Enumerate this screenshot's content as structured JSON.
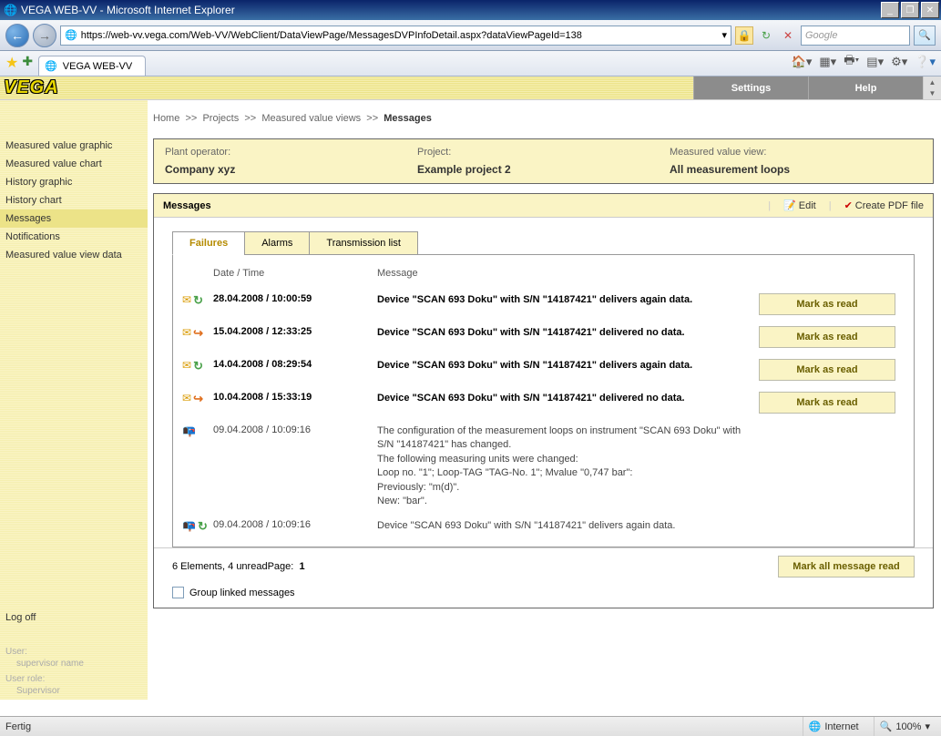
{
  "window": {
    "title": "VEGA WEB-VV - Microsoft Internet Explorer"
  },
  "browser": {
    "url": "https://web-vv.vega.com/Web-VV/WebClient/DataViewPage/MessagesDVPInfoDetail.aspx?dataViewPageId=138",
    "search_placeholder": "Google",
    "tab_title": "VEGA WEB-VV"
  },
  "header": {
    "logo": "VEGA",
    "settings": "Settings",
    "help": "Help"
  },
  "breadcrumb": {
    "home": "Home",
    "projects": "Projects",
    "views": "Measured value views",
    "current": "Messages",
    "sep": ">>"
  },
  "sidebar": {
    "items": [
      "Measured value graphic",
      "Measured value chart",
      "History graphic",
      "History chart",
      "Messages",
      "Notifications",
      "Measured value view data"
    ],
    "active_index": 4,
    "logoff": "Log off",
    "user_label": "User:",
    "user_value": "supervisor name",
    "role_label": "User role:",
    "role_value": "Supervisor"
  },
  "info": {
    "operator_label": "Plant operator:",
    "operator_value": "Company xyz",
    "project_label": "Project:",
    "project_value": "Example project 2",
    "view_label": "Measured value view:",
    "view_value": "All measurement loops"
  },
  "panel": {
    "title": "Messages",
    "edit": "Edit",
    "create_pdf": "Create PDF file"
  },
  "tabs": {
    "failures": "Failures",
    "alarms": "Alarms",
    "transmission": "Transmission list"
  },
  "columns": {
    "datetime": "Date / Time",
    "message": "Message"
  },
  "messages": [
    {
      "unread": true,
      "arrow": "green",
      "datetime": "28.04.2008 / 10:00:59",
      "text": "Device \"SCAN 693 Doku\" with S/N \"14187421\" delivers again data.",
      "mark": true
    },
    {
      "unread": true,
      "arrow": "orange",
      "datetime": "15.04.2008 / 12:33:25",
      "text": "Device \"SCAN 693 Doku\" with S/N \"14187421\" delivered no data.",
      "mark": true
    },
    {
      "unread": true,
      "arrow": "green",
      "datetime": "14.04.2008 / 08:29:54",
      "text": "Device \"SCAN 693 Doku\" with S/N \"14187421\" delivers again data.",
      "mark": true
    },
    {
      "unread": true,
      "arrow": "orange",
      "datetime": "10.04.2008 / 15:33:19",
      "text": "Device \"SCAN 693 Doku\" with S/N \"14187421\" delivered no data.",
      "mark": true
    },
    {
      "unread": false,
      "arrow": "",
      "datetime": "09.04.2008 / 10:09:16",
      "text": "The configuration of the measurement loops on instrument \"SCAN 693 Doku\" with S/N \"14187421\" has changed.\nThe following measuring units were changed:\nLoop no. \"1\"; Loop-TAG \"TAG-No. 1\"; Mvalue \"0,747 bar\":\nPreviously: \"m(d)\".\nNew: \"bar\".",
      "mark": false
    },
    {
      "unread": false,
      "arrow": "green",
      "datetime": "09.04.2008 / 10:09:16",
      "text": "Device \"SCAN 693 Doku\" with S/N \"14187421\" delivers again data.",
      "mark": false
    }
  ],
  "mark_label": "Mark as read",
  "footer": {
    "count": "6 Elements, 4 unread",
    "page_label": "Page:",
    "page_num": "1",
    "mark_all": "Mark all message read",
    "group": "Group linked messages"
  },
  "status": {
    "ready": "Fertig",
    "zone": "Internet",
    "zoom": "100%"
  }
}
